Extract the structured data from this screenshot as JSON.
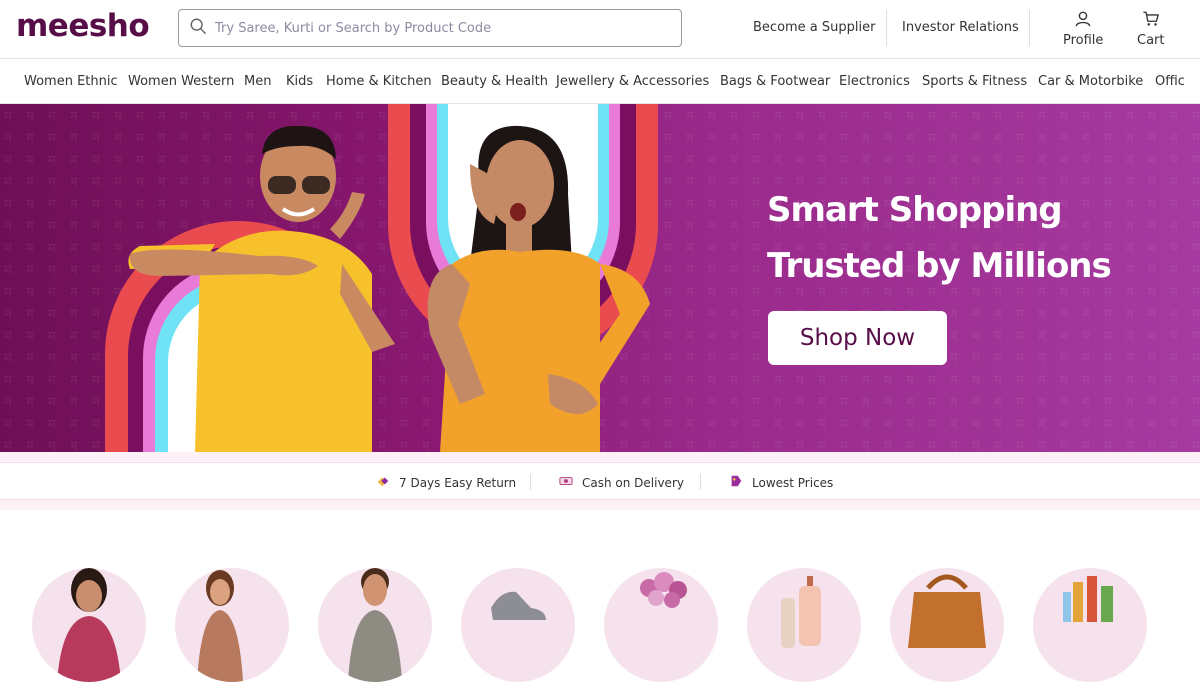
{
  "header": {
    "logo": "meesho",
    "search_placeholder": "Try Saree, Kurti or Search by Product Code",
    "become_supplier": "Become a Supplier",
    "investor_relations": "Investor Relations",
    "profile": "Profile",
    "cart": "Cart"
  },
  "categories": [
    "Women Ethnic",
    "Women Western",
    "Men",
    "Kids",
    "Home & Kitchen",
    "Beauty & Health",
    "Jewellery & Accessories",
    "Bags & Footwear",
    "Electronics",
    "Sports & Fitness",
    "Car & Motorbike",
    "Offic"
  ],
  "banner": {
    "headline_1": "Smart Shopping",
    "headline_2": "Trusted by Millions",
    "cta": "Shop Now"
  },
  "value_props": [
    {
      "label": "7 Days Easy Return",
      "icon": "return-icon"
    },
    {
      "label": "Cash on Delivery",
      "icon": "cash-icon"
    },
    {
      "label": "Lowest Prices",
      "icon": "price-tag-icon"
    }
  ],
  "colors": {
    "brand": "#570d48",
    "banner_gradient_start": "#6e0f57",
    "banner_gradient_end": "#a63aa0",
    "arch_red": "#ea4b4f",
    "arch_pink": "#e87ad8",
    "arch_cyan": "#6fe2f5",
    "shirt_yellow": "#f7c12c",
    "dress_orange": "#f2a12a",
    "circle_bg": "#f6e2ec"
  },
  "category_circles": [
    "women-ethnic-thumb",
    "women-western-thumb",
    "men-thumb",
    "footwear-thumb",
    "home-decor-thumb",
    "beauty-thumb",
    "bags-thumb",
    "grocery-thumb"
  ]
}
